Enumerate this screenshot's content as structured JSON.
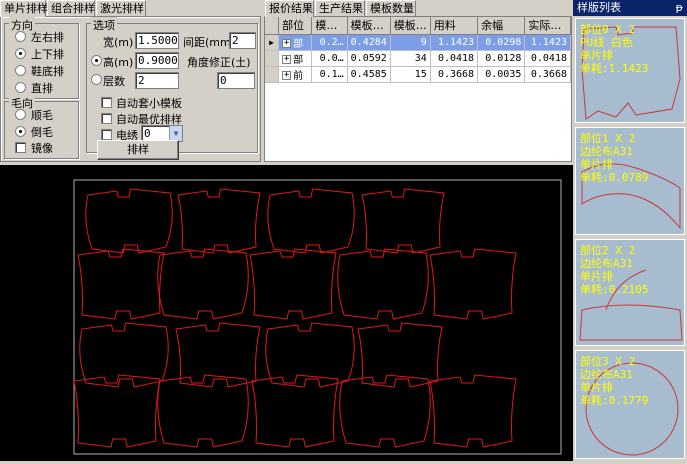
{
  "left_tabs": [
    "单片排样",
    "组合排样",
    "激光排样"
  ],
  "direction": {
    "title": "方向",
    "options": [
      "左右排",
      "上下排",
      "鞋底排",
      "直排"
    ],
    "selected_index": 1
  },
  "options": {
    "title": "选项",
    "width_label": "宽(m)",
    "width_value": "1.5000",
    "gap_label": "间距(mm)",
    "gap_value": "2",
    "height_label": "高(m)",
    "height_value": "0.9000",
    "angle_label": "角度修正(土)",
    "angle_value": "0",
    "layers_label": "层数",
    "layers_value": "2",
    "auto_min_label": "自动套小模板",
    "auto_best_label": "自动最优排样",
    "cable_label": "电绣",
    "cable_value": "0",
    "layout_button": "排样"
  },
  "nap": {
    "title": "毛向",
    "options": [
      "顺毛",
      "倒毛"
    ],
    "selected_index": 1,
    "mirror_label": "镜像"
  },
  "right_tabs": [
    "报价结果",
    "生产结果",
    "模板数量"
  ],
  "table": {
    "headers": [
      "部位",
      "模…",
      "模板…",
      "模板…",
      "用料",
      "余幅",
      "实际…"
    ],
    "rows": [
      [
        "部",
        "0.2…",
        "0.4284",
        "9",
        "1.1423",
        "0.0298",
        "1.1423"
      ],
      [
        "部",
        "0.0…",
        "0.0592",
        "34",
        "0.0418",
        "0.0128",
        "0.0418"
      ],
      [
        "前",
        "0.1…",
        "0.4585",
        "15",
        "0.3668",
        "0.0035",
        "0.3668"
      ]
    ]
  },
  "sample_list": {
    "title": "样版列表",
    "pin": "ᵽ",
    "cards": [
      [
        "部位0 X 2",
        "PU线 白色",
        "单片排",
        "单耗:1.1423"
      ],
      [
        "部位1 X 2",
        "边纶布A31",
        "单片排",
        "单耗:0.0789"
      ],
      [
        "部位2 X 2",
        "边纶布A31",
        "单片排",
        "单耗:0.2105"
      ],
      [
        "部位3 X 2",
        "边纶布A31",
        "单片排",
        "单耗:0.1779"
      ]
    ]
  },
  "colors": {
    "canvas": "#000000",
    "piece_stroke": "#e01818",
    "card_text": "#ffff00",
    "selected_row": "#7b9ee6"
  }
}
